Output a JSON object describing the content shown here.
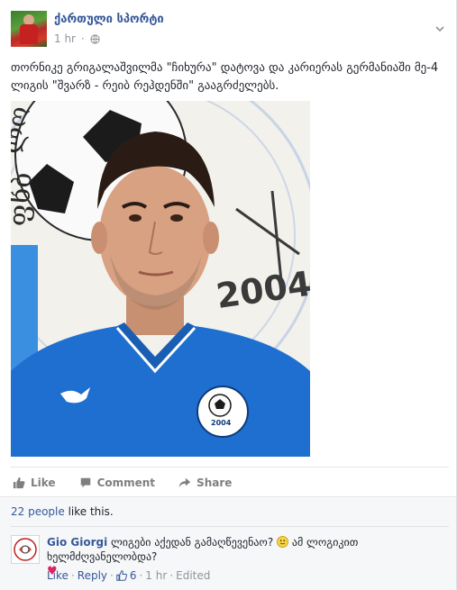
{
  "page": {
    "name": "ქართული სპორტი",
    "timestamp": "1 hr",
    "post_text": "თორნიკე გრიგალაშვილმა \"ჩიხურა\" დატოვა და კარიერას გერმანიაში მე-4 ლიგის \"შვარზ - რეიბ რეჰდენში\" გააგრძელებს."
  },
  "actions": {
    "like": "Like",
    "comment": "Comment",
    "share": "Share"
  },
  "likes_summary": {
    "people": "22 people",
    "suffix": " like this."
  },
  "comment": {
    "author": "Gio Giorgi",
    "text_part1": " ლიგები აქედან გამაღწევენაო? ",
    "text_part2": " ამ ლოგიკით ხელმძღვანელობდა?",
    "heart": "♥",
    "like": "Like",
    "reply": "Reply",
    "like_count": "6",
    "time": "1 hr",
    "edited": "Edited",
    "sep": "·"
  },
  "colors": {
    "link": "#365899",
    "meta": "#90949c",
    "jersey": "#1f6fd0"
  }
}
